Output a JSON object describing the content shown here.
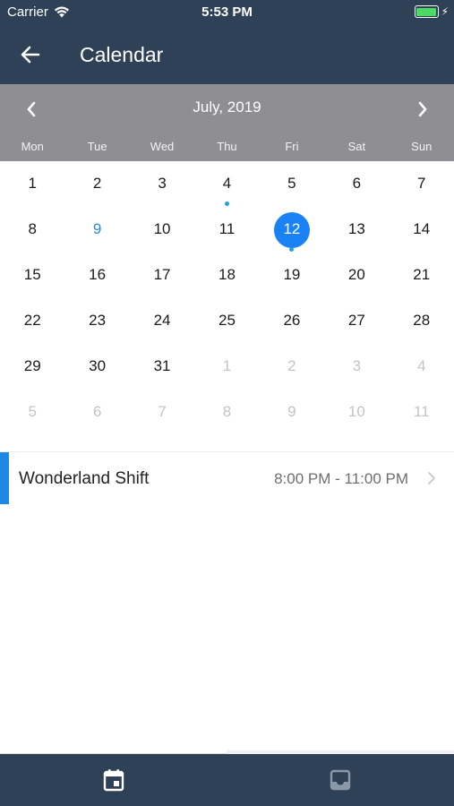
{
  "status_bar": {
    "carrier": "Carrier",
    "time": "5:53 PM",
    "battery_level": 1.0,
    "battery_color": "#4cd964"
  },
  "app_bar": {
    "title": "Calendar",
    "back_icon": "arrow-left-icon",
    "background": "#2f4156"
  },
  "calendar": {
    "month_label": "July, 2019",
    "prev_icon": "chevron-left-icon",
    "next_icon": "chevron-right-icon",
    "header_background": "#8e8e93",
    "weekdays": [
      "Mon",
      "Tue",
      "Wed",
      "Thu",
      "Fri",
      "Sat",
      "Sun"
    ],
    "selected_color": "#1a82f5",
    "today_color": "#2b8ad8",
    "dot_color": "#1ea5d8",
    "weeks": [
      [
        {
          "label": "1"
        },
        {
          "label": "2"
        },
        {
          "label": "3"
        },
        {
          "label": "4",
          "dot": true
        },
        {
          "label": "5"
        },
        {
          "label": "6"
        },
        {
          "label": "7"
        }
      ],
      [
        {
          "label": "8"
        },
        {
          "label": "9",
          "today": true
        },
        {
          "label": "10"
        },
        {
          "label": "11"
        },
        {
          "label": "12",
          "selected": true,
          "dot": true
        },
        {
          "label": "13"
        },
        {
          "label": "14"
        }
      ],
      [
        {
          "label": "15"
        },
        {
          "label": "16"
        },
        {
          "label": "17"
        },
        {
          "label": "18"
        },
        {
          "label": "19"
        },
        {
          "label": "20"
        },
        {
          "label": "21"
        }
      ],
      [
        {
          "label": "22"
        },
        {
          "label": "23"
        },
        {
          "label": "24"
        },
        {
          "label": "25"
        },
        {
          "label": "26"
        },
        {
          "label": "27"
        },
        {
          "label": "28"
        }
      ],
      [
        {
          "label": "29"
        },
        {
          "label": "30"
        },
        {
          "label": "31"
        },
        {
          "label": "1",
          "outside": true
        },
        {
          "label": "2",
          "outside": true
        },
        {
          "label": "3",
          "outside": true
        },
        {
          "label": "4",
          "outside": true
        }
      ],
      [
        {
          "label": "5",
          "outside": true
        },
        {
          "label": "6",
          "outside": true
        },
        {
          "label": "7",
          "outside": true
        },
        {
          "label": "8",
          "outside": true
        },
        {
          "label": "9",
          "outside": true
        },
        {
          "label": "10",
          "outside": true
        },
        {
          "label": "11",
          "outside": true
        }
      ]
    ]
  },
  "events": [
    {
      "title": "Wonderland Shift",
      "time": "8:00 PM - 11:00 PM",
      "accent": "#1e88e5",
      "chevron_icon": "chevron-right-icon"
    }
  ],
  "tab_bar": {
    "tabs": [
      {
        "icon": "calendar-icon",
        "active": true
      },
      {
        "icon": "inbox-icon",
        "active": false
      }
    ]
  }
}
